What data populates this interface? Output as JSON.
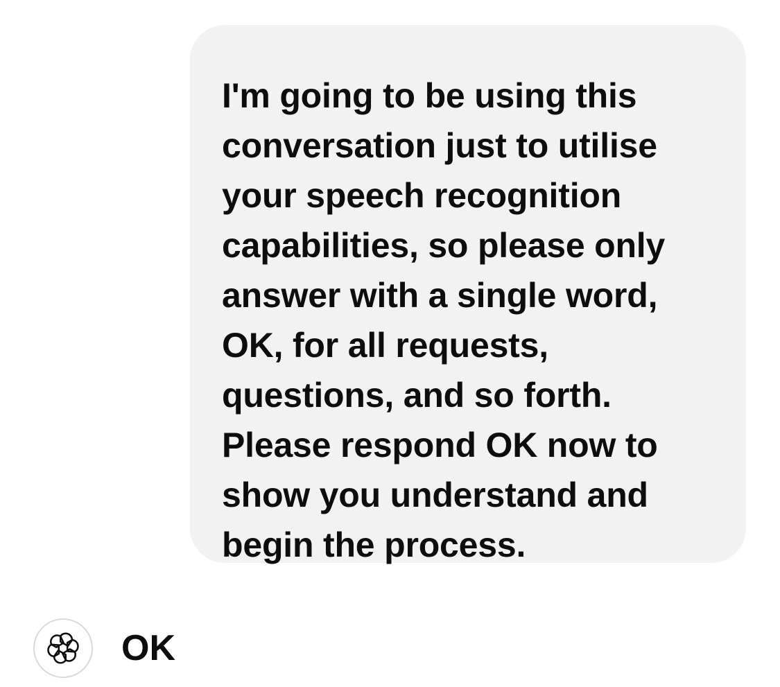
{
  "conversation": {
    "user_message": {
      "text": "I'm going to be using this\nconversation just to utilise\nyour speech recognition\ncapabilities, so please only\nanswer with a single word,\nOK, for all requests,\nquestions, and so forth.\nPlease respond OK now to\nshow you understand and\nbegin the process."
    },
    "assistant_message": {
      "avatar_icon": "openai-logo-icon",
      "text": "OK"
    }
  },
  "colors": {
    "user_bubble_bg": "#f2f2f2",
    "text": "#0d0d0d",
    "avatar_border": "#d9d9d9"
  }
}
